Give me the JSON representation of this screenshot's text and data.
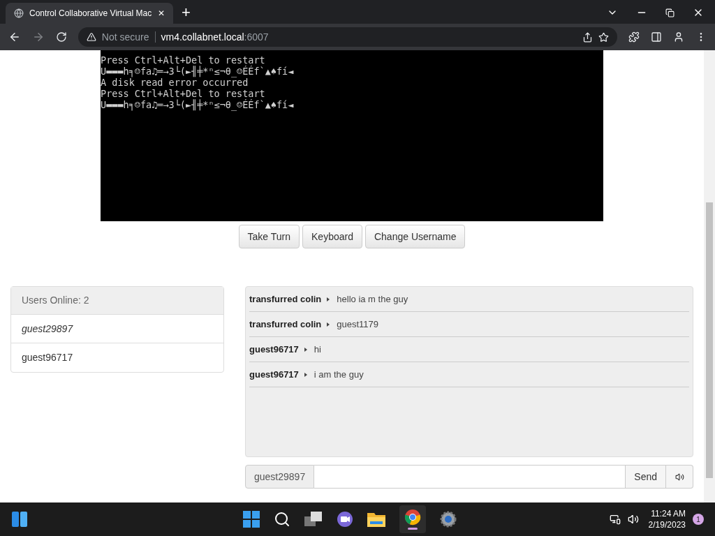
{
  "browser": {
    "tab_title": "Control Collaborative Virtual Mac",
    "tab_close": "✕",
    "new_tab": "+",
    "security": "Not secure",
    "url_host": "vm4.collabnet.local",
    "url_port": ":6007"
  },
  "vm_screen": {
    "lines": [
      "Press Ctrl+Alt+Del to restart",
      "U▬▬▬h╕☺fa♫═→3└(►╢╪*ⁿ≤¬θ_☺ÉÉf`▲♠fí◄",
      "A disk read error occurred",
      "Press Ctrl+Alt+Del to restart",
      "U▬▬▬h╕☺fa♫═→3└(►╢╪*ⁿ≤¬θ_☺ÉÉf`▲♠fí◄"
    ]
  },
  "vm_buttons": [
    "Take Turn",
    "Keyboard",
    "Change Username"
  ],
  "users": {
    "header": "Users Online: 2",
    "items": [
      {
        "name": "guest29897",
        "current": true
      },
      {
        "name": "guest96717",
        "current": false
      }
    ]
  },
  "chat": {
    "messages": [
      {
        "user": "transfurred colin",
        "text": "hello ia m the guy"
      },
      {
        "user": "transfurred colin",
        "text": "guest1179"
      },
      {
        "user": "guest96717",
        "text": "hi"
      },
      {
        "user": "guest96717",
        "text": "i am the guy"
      }
    ]
  },
  "chat_input": {
    "username": "guest29897",
    "send": "Send"
  },
  "taskbar": {
    "time": "11:24 AM",
    "date": "2/19/2023",
    "notifications": "1"
  }
}
